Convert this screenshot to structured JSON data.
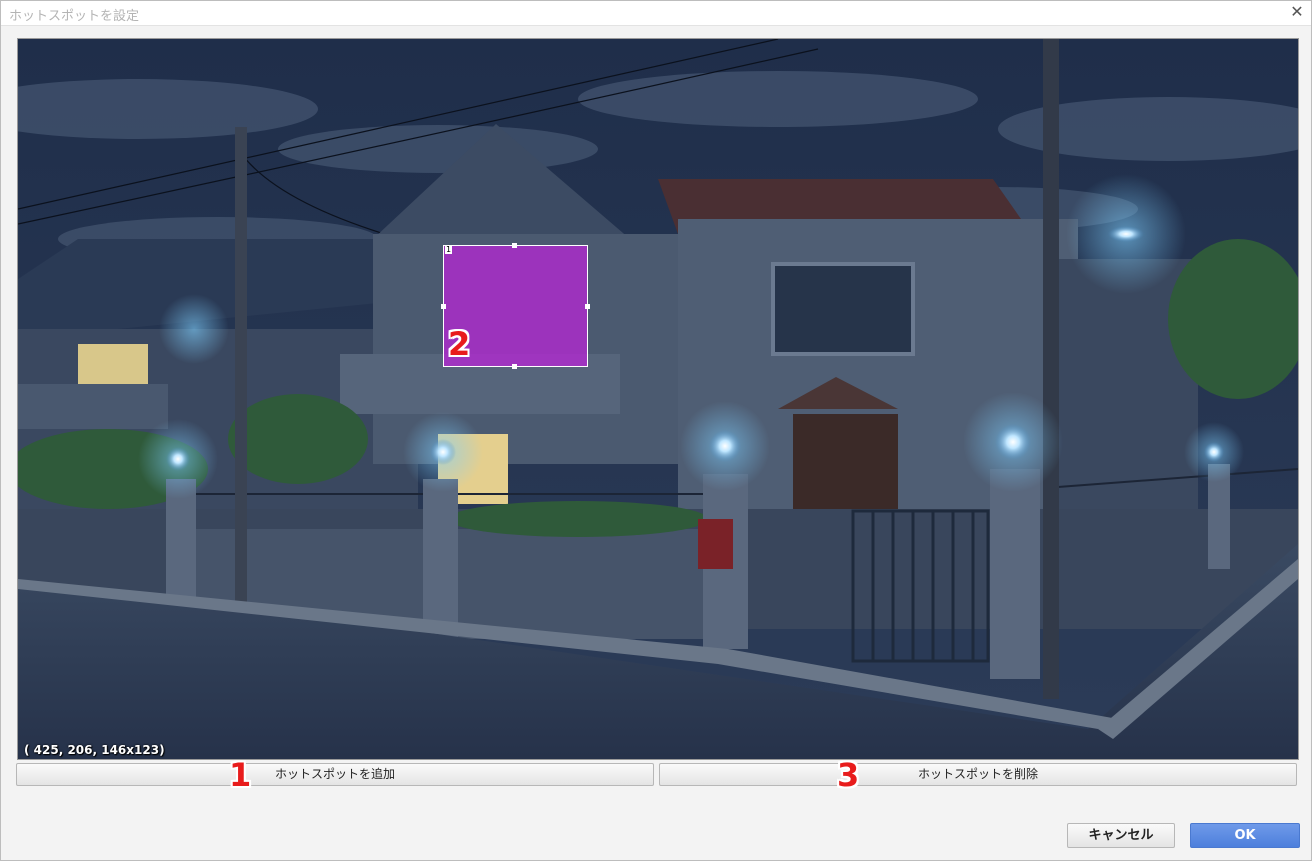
{
  "window": {
    "title": "ホットスポットを設定",
    "close_icon": "close-icon"
  },
  "scene": {
    "coordinates_readout": "( 425,  206, 146x123)",
    "hotspot": {
      "index_label": "1",
      "fill_color": "#b428d2",
      "border_color": "#ffffff"
    }
  },
  "buttons": {
    "add_hotspot": "ホットスポットを追加",
    "delete_hotspot": "ホットスポットを削除",
    "cancel": "キャンセル",
    "ok": "OK"
  },
  "markers": {
    "m1": "1",
    "m2": "2",
    "m3": "3"
  },
  "colors": {
    "accent": "#4d7fdc",
    "marker": "#e81c1c"
  }
}
